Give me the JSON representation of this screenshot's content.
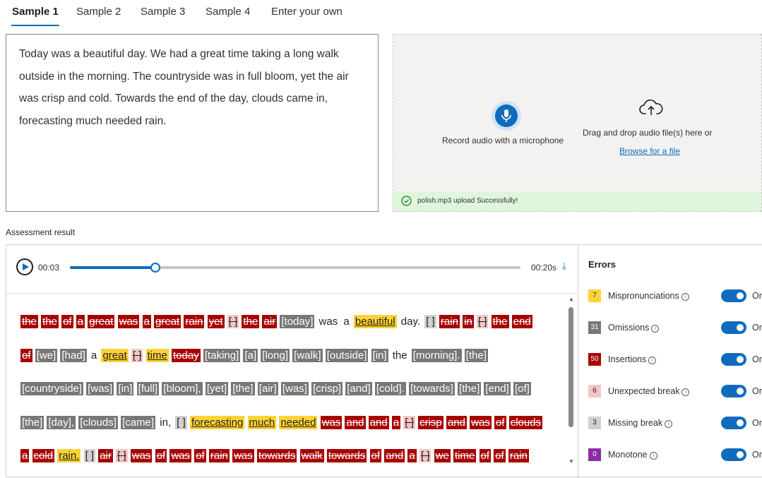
{
  "tabs": [
    "Sample 1",
    "Sample 2",
    "Sample 3",
    "Sample 4",
    "Enter your own"
  ],
  "reference_text": "Today was a beautiful day. We had a great time taking a long walk outside in the morning. The countryside was in full bloom, yet the air was crisp and cold. Towards the end of the day, clouds came in, forecasting much needed rain.",
  "upload": {
    "record_label": "Record audio with a microphone",
    "drag_label": "Drag and drop audio file(s) here or",
    "browse_label": "Browse for a file",
    "success_message": "polish.mp3 upload Successfully!"
  },
  "assessment_title": "Assessment result",
  "player": {
    "current_time": "00:03",
    "total_time": "00:20s",
    "progress": 0.19
  },
  "words": [
    {
      "t": "the",
      "k": "ins"
    },
    {
      "t": "the",
      "k": "ins"
    },
    {
      "t": "of",
      "k": "ins"
    },
    {
      "t": "a",
      "k": "ins"
    },
    {
      "t": "great",
      "k": "ins"
    },
    {
      "t": "was",
      "k": "ins"
    },
    {
      "t": "a",
      "k": "ins"
    },
    {
      "t": "great",
      "k": "ins"
    },
    {
      "t": "rain",
      "k": "ins"
    },
    {
      "t": "yet",
      "k": "ins"
    },
    {
      "t": "[ ]",
      "k": "ub"
    },
    {
      "t": "the",
      "k": "ins"
    },
    {
      "t": "air",
      "k": "ins"
    },
    {
      "t": "[today]",
      "k": "om"
    },
    {
      "t": "was",
      "k": "ok"
    },
    {
      "t": "a",
      "k": "ok"
    },
    {
      "t": "beautiful",
      "k": "mis"
    },
    {
      "t": "day.",
      "k": "ok"
    },
    {
      "t": "[ ]",
      "k": "mb"
    },
    {
      "t": "rain",
      "k": "ins"
    },
    {
      "t": "in",
      "k": "ins"
    },
    {
      "t": "[ ]",
      "k": "ub"
    },
    {
      "t": "the",
      "k": "ins"
    },
    {
      "t": "end",
      "k": "ins"
    },
    {
      "t": "of",
      "k": "ins"
    },
    {
      "t": "[we]",
      "k": "om"
    },
    {
      "t": "[had]",
      "k": "om"
    },
    {
      "t": "a",
      "k": "ok"
    },
    {
      "t": "great",
      "k": "mis"
    },
    {
      "t": "[ ]",
      "k": "ub"
    },
    {
      "t": "time",
      "k": "mis"
    },
    {
      "t": "today",
      "k": "ins"
    },
    {
      "t": "[taking]",
      "k": "om"
    },
    {
      "t": "[a]",
      "k": "om"
    },
    {
      "t": "[long]",
      "k": "om"
    },
    {
      "t": "[walk]",
      "k": "om"
    },
    {
      "t": "[outside]",
      "k": "om"
    },
    {
      "t": "[in]",
      "k": "om"
    },
    {
      "t": "the",
      "k": "ok"
    },
    {
      "t": "[morning].",
      "k": "om"
    },
    {
      "t": "[the]",
      "k": "om"
    },
    {
      "t": "[countryside]",
      "k": "om"
    },
    {
      "t": "[was]",
      "k": "om"
    },
    {
      "t": "[in]",
      "k": "om"
    },
    {
      "t": "[full]",
      "k": "om"
    },
    {
      "t": "[bloom],",
      "k": "om"
    },
    {
      "t": "[yet]",
      "k": "om"
    },
    {
      "t": "[the]",
      "k": "om"
    },
    {
      "t": "[air]",
      "k": "om"
    },
    {
      "t": "[was]",
      "k": "om"
    },
    {
      "t": "[crisp]",
      "k": "om"
    },
    {
      "t": "[and]",
      "k": "om"
    },
    {
      "t": "[cold].",
      "k": "om"
    },
    {
      "t": "[towards]",
      "k": "om"
    },
    {
      "t": "[the]",
      "k": "om"
    },
    {
      "t": "[end]",
      "k": "om"
    },
    {
      "t": "[of]",
      "k": "om"
    },
    {
      "t": "[the]",
      "k": "om"
    },
    {
      "t": "[day],",
      "k": "om"
    },
    {
      "t": "[clouds]",
      "k": "om"
    },
    {
      "t": "[came]",
      "k": "om"
    },
    {
      "t": "in,",
      "k": "ok"
    },
    {
      "t": "[ ]",
      "k": "mb"
    },
    {
      "t": "forecasting",
      "k": "mis"
    },
    {
      "t": "much",
      "k": "mis"
    },
    {
      "t": "needed",
      "k": "mis"
    },
    {
      "t": "was",
      "k": "ins"
    },
    {
      "t": "and",
      "k": "ins"
    },
    {
      "t": "and",
      "k": "ins"
    },
    {
      "t": "a",
      "k": "ins"
    },
    {
      "t": "[ ]",
      "k": "ub"
    },
    {
      "t": "crisp",
      "k": "ins"
    },
    {
      "t": "and",
      "k": "ins"
    },
    {
      "t": "was",
      "k": "ins"
    },
    {
      "t": "of",
      "k": "ins"
    },
    {
      "t": "clouds",
      "k": "ins"
    },
    {
      "t": "a",
      "k": "ins"
    },
    {
      "t": "cold",
      "k": "ins"
    },
    {
      "t": "rain.",
      "k": "mis"
    },
    {
      "t": "[ ]",
      "k": "mb"
    },
    {
      "t": "air",
      "k": "ins"
    },
    {
      "t": "[ ]",
      "k": "ub"
    },
    {
      "t": "was",
      "k": "ins"
    },
    {
      "t": "of",
      "k": "ins"
    },
    {
      "t": "was",
      "k": "ins"
    },
    {
      "t": "of",
      "k": "ins"
    },
    {
      "t": "rain",
      "k": "ins"
    },
    {
      "t": "was",
      "k": "ins"
    },
    {
      "t": "towards",
      "k": "ins"
    },
    {
      "t": "walk",
      "k": "ins"
    },
    {
      "t": "towards",
      "k": "ins"
    },
    {
      "t": "of",
      "k": "ins"
    },
    {
      "t": "and",
      "k": "ins"
    },
    {
      "t": "a",
      "k": "ins"
    },
    {
      "t": "[ ]",
      "k": "ub"
    },
    {
      "t": "we",
      "k": "ins"
    },
    {
      "t": "time",
      "k": "ins"
    },
    {
      "t": "of",
      "k": "ins"
    },
    {
      "t": "of",
      "k": "ins"
    },
    {
      "t": "rain",
      "k": "ins"
    }
  ],
  "errors_panel": {
    "title": "Errors",
    "toggle_label": "On",
    "items": [
      {
        "count": "7",
        "label": "Mispronunciations",
        "bg": "#ffd335",
        "fg": "#201f1e"
      },
      {
        "count": "31",
        "label": "Omissions",
        "bg": "#797775",
        "fg": "#ffffff"
      },
      {
        "count": "50",
        "label": "Insertions",
        "bg": "#a80000",
        "fg": "#ffffff"
      },
      {
        "count": "6",
        "label": "Unexpected break",
        "bg": "#f3c6c6",
        "fg": "#201f1e"
      },
      {
        "count": "3",
        "label": "Missing break",
        "bg": "#d2d0ce",
        "fg": "#201f1e"
      },
      {
        "count": "0",
        "label": "Monotone",
        "bg": "#8a2da5",
        "fg": "#ffffff"
      }
    ]
  }
}
